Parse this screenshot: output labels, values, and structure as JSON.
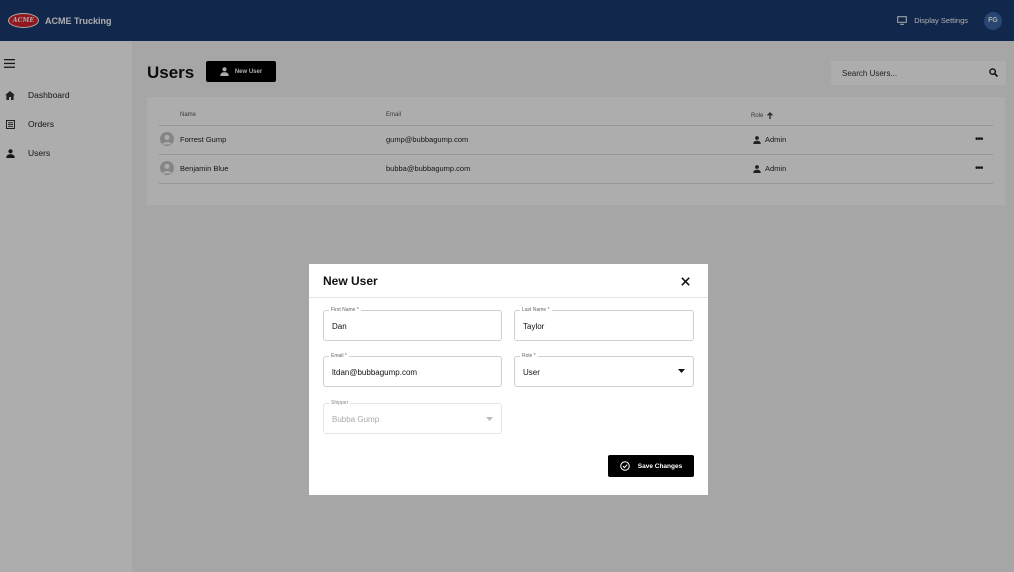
{
  "header": {
    "logo_text": "ACME",
    "app_title": "ACME Trucking",
    "display_settings_label": "Display Settings",
    "display_settings_icon": "monitor-icon",
    "user_initials": "FG"
  },
  "sidebar": {
    "menu_icon": "hamburger-icon",
    "items": [
      {
        "label": "Dashboard",
        "icon": "home-icon"
      },
      {
        "label": "Orders",
        "icon": "list-icon"
      },
      {
        "label": "Users",
        "icon": "person-icon"
      }
    ]
  },
  "main": {
    "page_title": "Users",
    "new_user_button": "New User",
    "search_placeholder": "Search Users...",
    "table": {
      "columns": [
        "Name",
        "Email",
        "Role"
      ],
      "sort_column": "Role",
      "sort_direction": "ascending",
      "rows": [
        {
          "name": "Forrest Gump",
          "email": "gump@bubbagump.com",
          "role": "Admin"
        },
        {
          "name": "Benjamin Blue",
          "email": "bubba@bubbagump.com",
          "role": "Admin"
        }
      ]
    }
  },
  "modal": {
    "title": "New User",
    "fields": {
      "first_name": {
        "label": "First Name *",
        "value": "Dan"
      },
      "last_name": {
        "label": "Last Name *",
        "value": "Taylor"
      },
      "email": {
        "label": "Email *",
        "value": "ltdan@bubbagump.com"
      },
      "role": {
        "label": "Role *",
        "value": "User"
      },
      "shipper": {
        "label": "Shipper",
        "value": "Bubba Gump",
        "disabled": true
      }
    },
    "save_button": "Save Changes"
  },
  "colors": {
    "header_bg": "#1b3a70",
    "logo_red": "#d9232e",
    "avatar_blue": "#3d66a8",
    "primary_button": "#000000",
    "overlay": "rgba(0,0,0,0.32)"
  }
}
